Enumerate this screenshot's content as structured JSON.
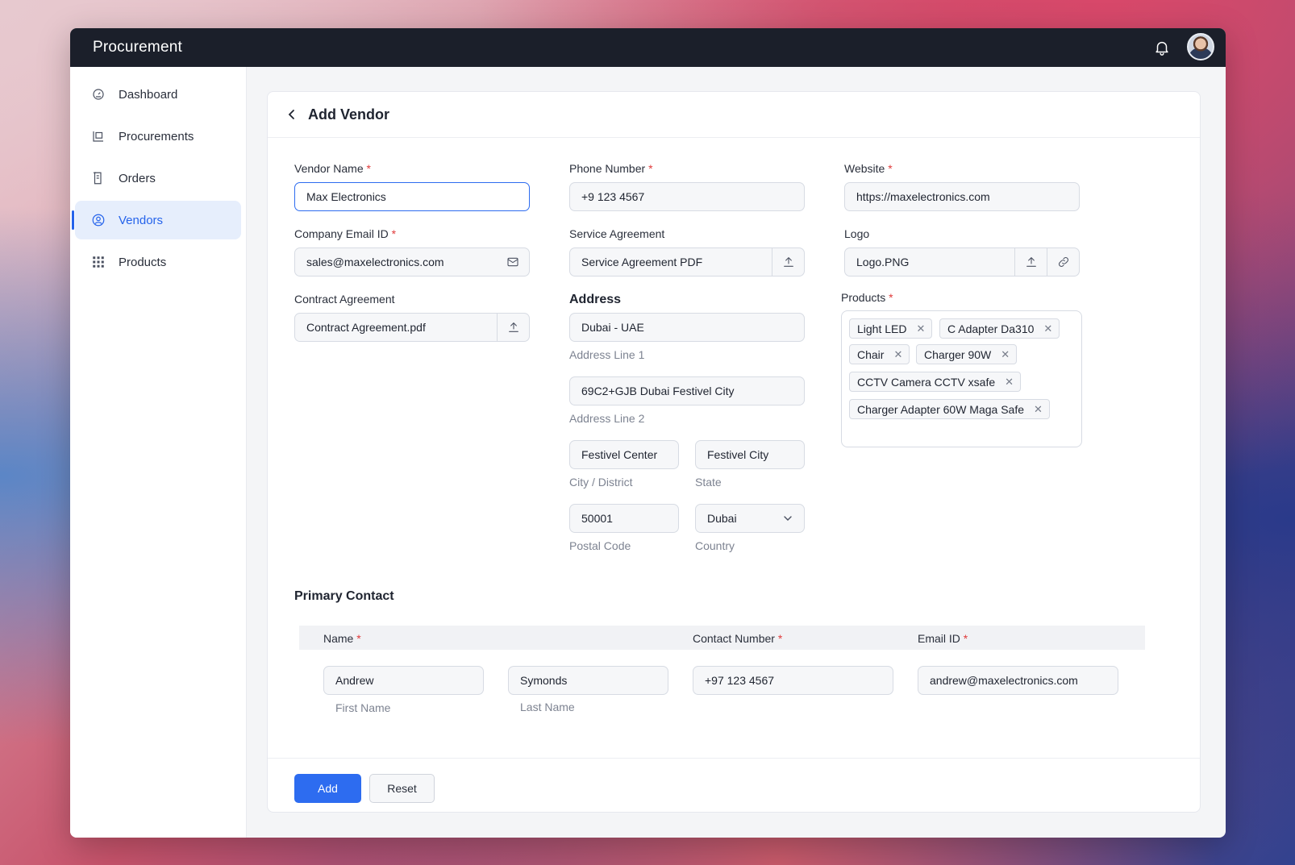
{
  "app": {
    "title": "Procurement"
  },
  "sidebar": {
    "items": [
      {
        "label": "Dashboard",
        "icon": "dashboard-icon"
      },
      {
        "label": "Procurements",
        "icon": "procurements-icon"
      },
      {
        "label": "Orders",
        "icon": "orders-icon"
      },
      {
        "label": "Vendors",
        "icon": "vendors-icon",
        "active": true
      },
      {
        "label": "Products",
        "icon": "products-grid-icon"
      }
    ]
  },
  "page": {
    "title": "Add Vendor"
  },
  "form": {
    "required_mark": "*",
    "vendor_name": {
      "label": "Vendor Name",
      "value": "Max Electronics"
    },
    "company_email": {
      "label": "Company Email ID",
      "value": "sales@maxelectronics.com"
    },
    "contract_agreement": {
      "label": "Contract Agreement",
      "value": "Contract Agreement.pdf"
    },
    "phone": {
      "label": "Phone Number",
      "value": "+9 123 4567"
    },
    "service_agreement": {
      "label": "Service Agreement",
      "value": "Service Agreement PDF"
    },
    "address": {
      "title": "Address",
      "line1": {
        "value": "Dubai - UAE",
        "hint": "Address Line 1"
      },
      "line2": {
        "value": "69C2+GJB Dubai Festivel City",
        "hint": "Address Line 2"
      },
      "city": {
        "value": "Festivel Center",
        "hint": "City / District"
      },
      "state": {
        "value": "Festivel City",
        "hint": "State"
      },
      "postal": {
        "value": "50001",
        "hint": "Postal Code"
      },
      "country": {
        "value": "Dubai",
        "hint": "Country"
      }
    },
    "website": {
      "label": "Website",
      "value": "https://maxelectronics.com"
    },
    "logo": {
      "label": "Logo",
      "value": "Logo.PNG"
    },
    "products": {
      "label": "Products",
      "tags": [
        "Light LED",
        "C Adapter Da310",
        "Chair",
        "Charger 90W",
        "CCTV Camera CCTV xsafe",
        "Charger Adapter 60W Maga Safe"
      ],
      "remove_glyph": "✕"
    }
  },
  "primary_contact": {
    "title": "Primary Contact",
    "headers": {
      "name": "Name",
      "contact_number": "Contact Number",
      "email": "Email ID"
    },
    "first_name": {
      "value": "Andrew",
      "hint": "First Name"
    },
    "last_name": {
      "value": "Symonds",
      "hint": "Last Name"
    },
    "contact_number": "+97 123 4567",
    "email": "andrew@maxelectronics.com"
  },
  "actions": {
    "add": "Add",
    "reset": "Reset"
  },
  "colors": {
    "accent": "#2d6cf0",
    "topbar": "#1b1f2a",
    "required": "#e03b3b"
  }
}
